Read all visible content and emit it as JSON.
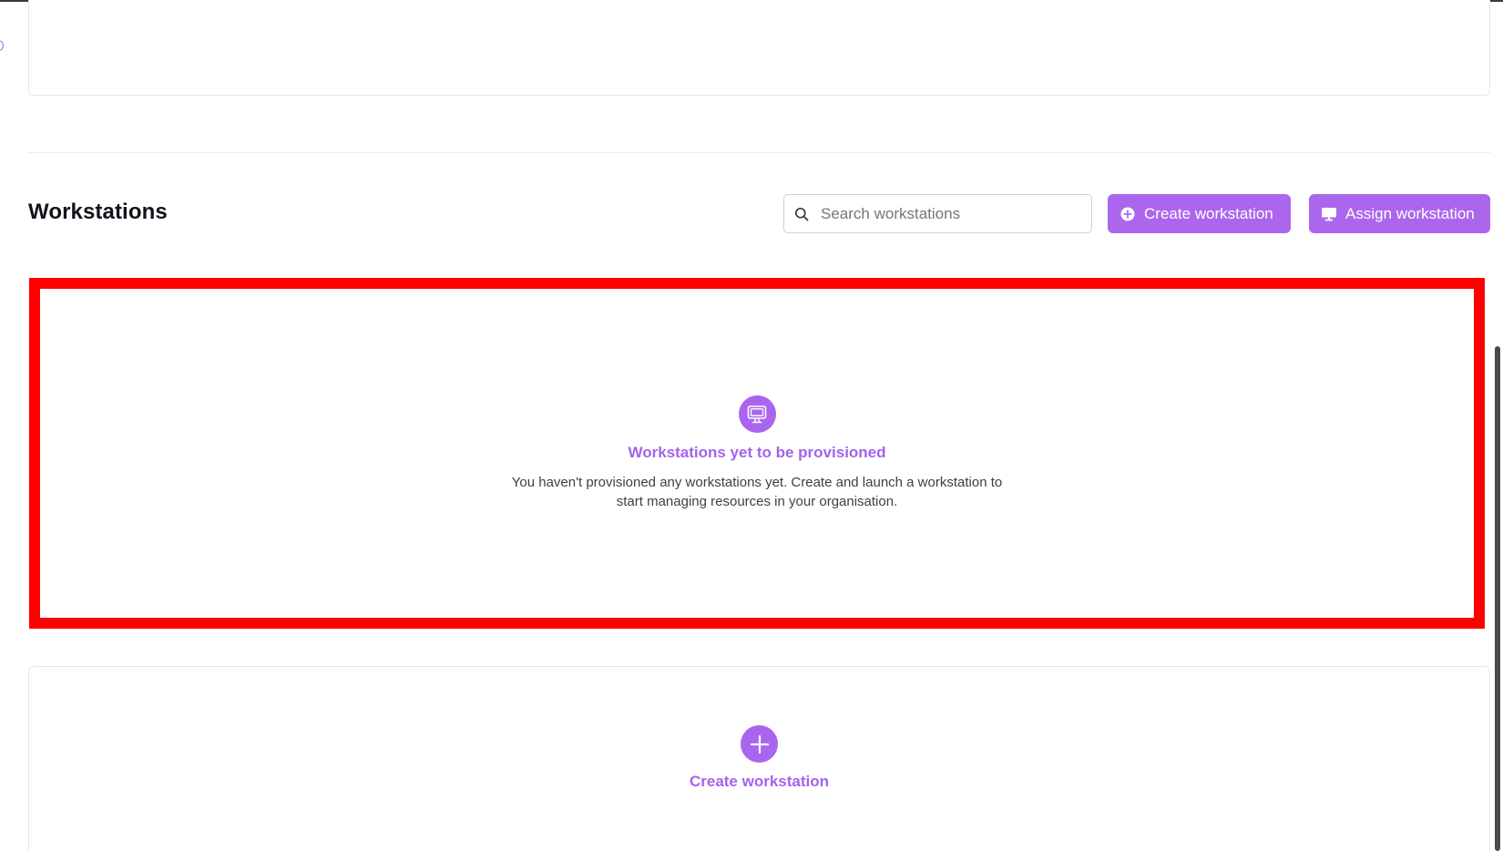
{
  "section": {
    "title": "Workstations"
  },
  "search": {
    "placeholder": "Search workstations",
    "value": ""
  },
  "actions": {
    "create_label": "Create workstation",
    "assign_label": "Assign workstation"
  },
  "empty_state": {
    "icon": "monitor-icon",
    "title": "Workstations yet to be provisioned",
    "description": "You haven't provisioned any workstations yet. Create and launch a workstation to start managing resources in your organisation."
  },
  "add_card": {
    "icon": "plus-icon",
    "label": "Create workstation"
  },
  "colors": {
    "accent": "#ac66ee",
    "highlight": "#ff0000",
    "title_text": "#12131a",
    "body_text": "#3e4048"
  }
}
